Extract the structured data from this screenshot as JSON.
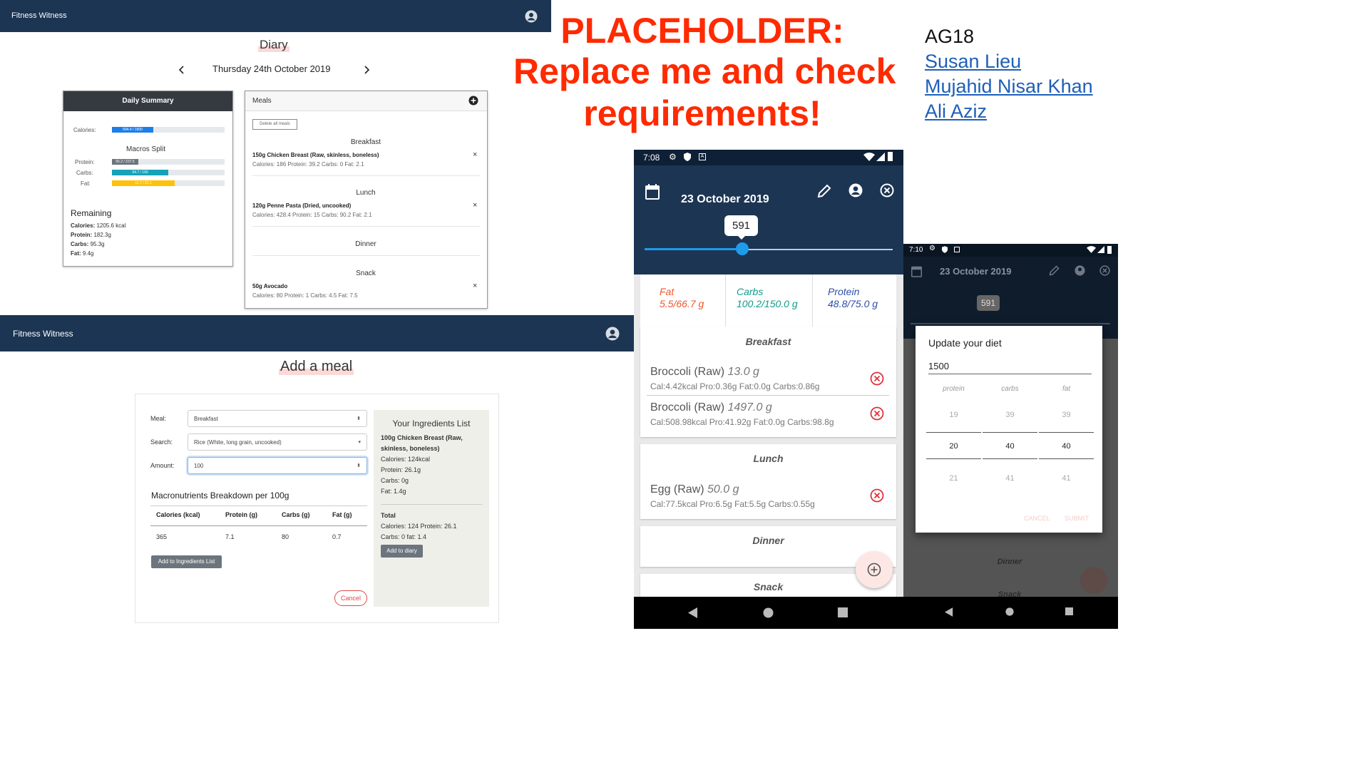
{
  "diary_web": {
    "brand": "Fitness Witness",
    "title": "Diary",
    "date": "Thursday 24th October 2019",
    "summary": {
      "header": "Daily Summary",
      "calories_label": "Calories:",
      "calories_bar_text": "694.4 / 1900",
      "calories_fraction": 0.37,
      "macros_title": "Macros Split",
      "protein_label": "Protein:",
      "protein_bar_text": "55.2 / 237.5",
      "protein_fraction": 0.23,
      "carbs_label": "Carbs:",
      "carbs_bar_text": "94.7 / 190",
      "carbs_fraction": 0.5,
      "fat_label": "Fat:",
      "fat_bar_text": "11.7 / 21.1",
      "fat_fraction": 0.56,
      "remaining_title": "Remaining",
      "remaining": [
        {
          "label": "Calories:",
          "value": " 1205.6 kcal"
        },
        {
          "label": "Protein:",
          "value": " 182.3g"
        },
        {
          "label": "Carbs:",
          "value": " 95.3g"
        },
        {
          "label": "Fat:",
          "value": " 9.4g"
        }
      ]
    },
    "meals": {
      "header": "Meals",
      "delete_all": "Delete all meals",
      "breakfast": "Breakfast",
      "breakfast_item": "150g Chicken Breast (Raw, skinless, boneless)",
      "breakfast_detail": "Calories: 186 Protein: 39.2 Carbs: 0 Fat: 2.1",
      "lunch": "Lunch",
      "lunch_item": "120g Penne Pasta (Dried, uncooked)",
      "lunch_detail": "Calories: 428.4 Protein: 15 Carbs: 90.2 Fat: 2.1",
      "dinner": "Dinner",
      "snack": "Snack",
      "snack_item": "50g Avocado",
      "snack_detail": "Calories: 80 Protein: 1 Carbs: 4.5 Fat: 7.5",
      "remove": "×"
    }
  },
  "addmeal_web": {
    "brand": "Fitness Witness",
    "title": "Add a meal",
    "meal_label": "Meal:",
    "meal_value": "Breakfast",
    "search_label": "Search:",
    "search_value": "Rice (White, long grain, uncooked)",
    "amount_label": "Amount:",
    "amount_value": "100",
    "breakdown_title": "Macronutrients Breakdown per 100g",
    "columns": [
      "Calories (kcal)",
      "Protein (g)",
      "Carbs (g)",
      "Fat (g)"
    ],
    "values": [
      "365",
      "7.1",
      "80",
      "0.7"
    ],
    "add_ingredient_btn": "Add to Ingredients List",
    "cancel_btn": "Cancel",
    "ingredients": {
      "title": "Your Ingredients List",
      "item_line1": "100g Chicken Breast (Raw,",
      "item_line2": "skinless, boneless)",
      "calories": "Calories: 124kcal",
      "protein": "Protein: 26.1g",
      "carbs": "Carbs: 0g",
      "fat": "Fat: 1.4g",
      "total_label": "Total",
      "total_line1": "Calories: 124 Protein: 26.1",
      "total_line2": "Carbs: 0 fat: 1.4",
      "add_to_diary": "Add to diary"
    }
  },
  "placeholder": {
    "line1": "PLACEHOLDER:",
    "line2": "Replace me and check",
    "line3": "requirements!",
    "color": "#ff2a00"
  },
  "team": {
    "name": "AG18",
    "members": [
      "Susan Lieu",
      "Mujahid Nisar Khan",
      "Ali Aziz"
    ]
  },
  "phone1": {
    "time": "7:08",
    "date": "23 October 2019",
    "slider_value": "591",
    "fat": {
      "label": "Fat",
      "value": "5.5/66.7 g",
      "color": "#f0552e"
    },
    "carbs": {
      "label": "Carbs",
      "value": "100.2/150.0 g",
      "color": "#0f9c8a"
    },
    "protein": {
      "label": "Protein",
      "value": "48.8/75.0 g",
      "color": "#2e4fa8"
    },
    "breakfast": "Breakfast",
    "b1_name": "Broccoli (Raw)",
    "b1_amount": "13.0 g",
    "b1_detail": "Cal:4.42kcal Pro:0.36g Fat:0.0g Carbs:0.86g",
    "b2_name": "Broccoli (Raw)",
    "b2_amount": "1497.0 g",
    "b2_detail": "Cal:508.98kcal Pro:41.92g Fat:0.0g Carbs:98.8g",
    "lunch": "Lunch",
    "l1_name": "Egg (Raw)",
    "l1_amount": "50.0 g",
    "l1_detail": "Cal:77.5kcal Pro:6.5g Fat:5.5g Carbs:0.55g",
    "dinner": "Dinner",
    "snack": "Snack"
  },
  "phone2": {
    "time": "7:10",
    "date": "23 October 2019",
    "slider_value": "591",
    "dialog_title": "Update your diet",
    "input_value": "1500",
    "col_protein": "protein",
    "col_carbs": "carbs",
    "col_fat": "fat",
    "protein_prev": "19",
    "protein_sel": "20",
    "protein_next": "21",
    "carbs_prev": "39",
    "carbs_sel": "40",
    "carbs_next": "41",
    "fat_prev": "39",
    "fat_sel": "40",
    "fat_next": "41",
    "cancel": "CANCEL",
    "submit": "SUBMIT",
    "dinner": "Dinner",
    "snack": "Snack"
  }
}
